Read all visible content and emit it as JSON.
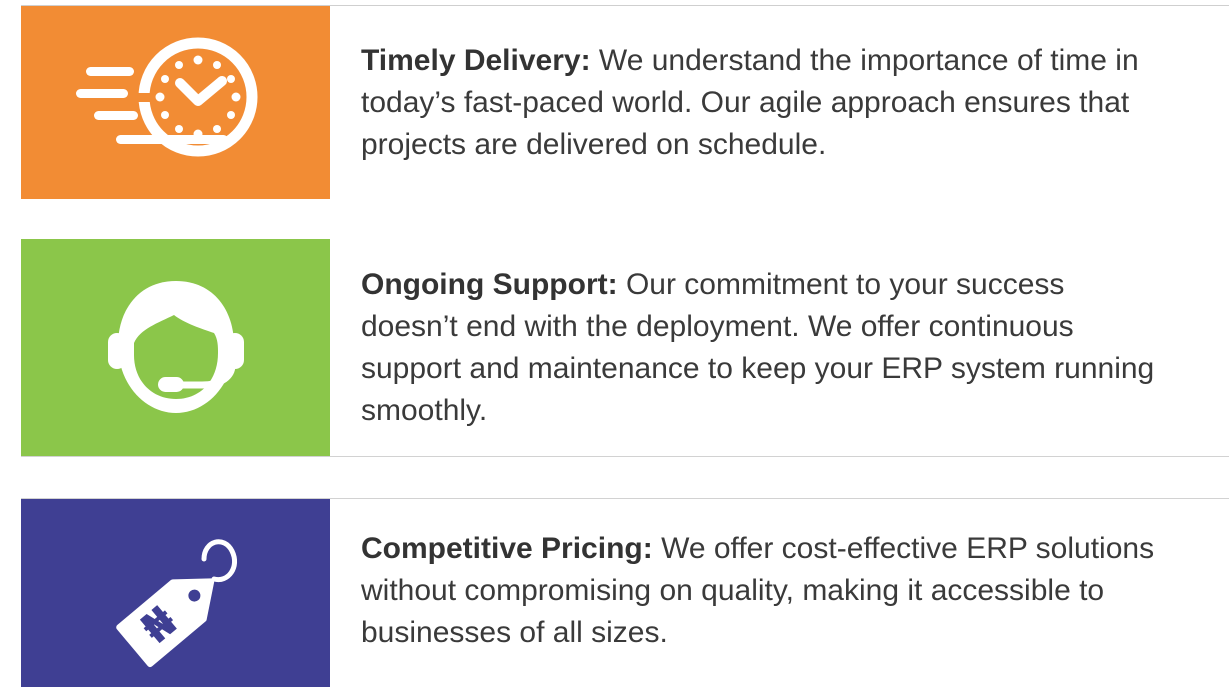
{
  "colors": {
    "timely": "#f28c34",
    "support": "#8bc64a",
    "pricing": "#3f3f93",
    "text": "#3a3a3a"
  },
  "features": [
    {
      "icon": "fast-clock-icon",
      "title": "Timely Delivery:",
      "description": "We understand the importance of time in today’s fast-paced world. Our agile approach ensures that projects are delivered on schedule."
    },
    {
      "icon": "headset-support-icon",
      "title": "Ongoing Support:",
      "description": "Our commitment to your success doesn’t end with the deployment. We offer continuous support and maintenance to keep your ERP system running smoothly."
    },
    {
      "icon": "naira-price-tag-icon",
      "title": "Competitive Pricing:",
      "description": "We offer cost-effective ERP solutions without compromising on quality, making it accessible to businesses of all sizes.",
      "tag_symbol": "₦"
    }
  ]
}
